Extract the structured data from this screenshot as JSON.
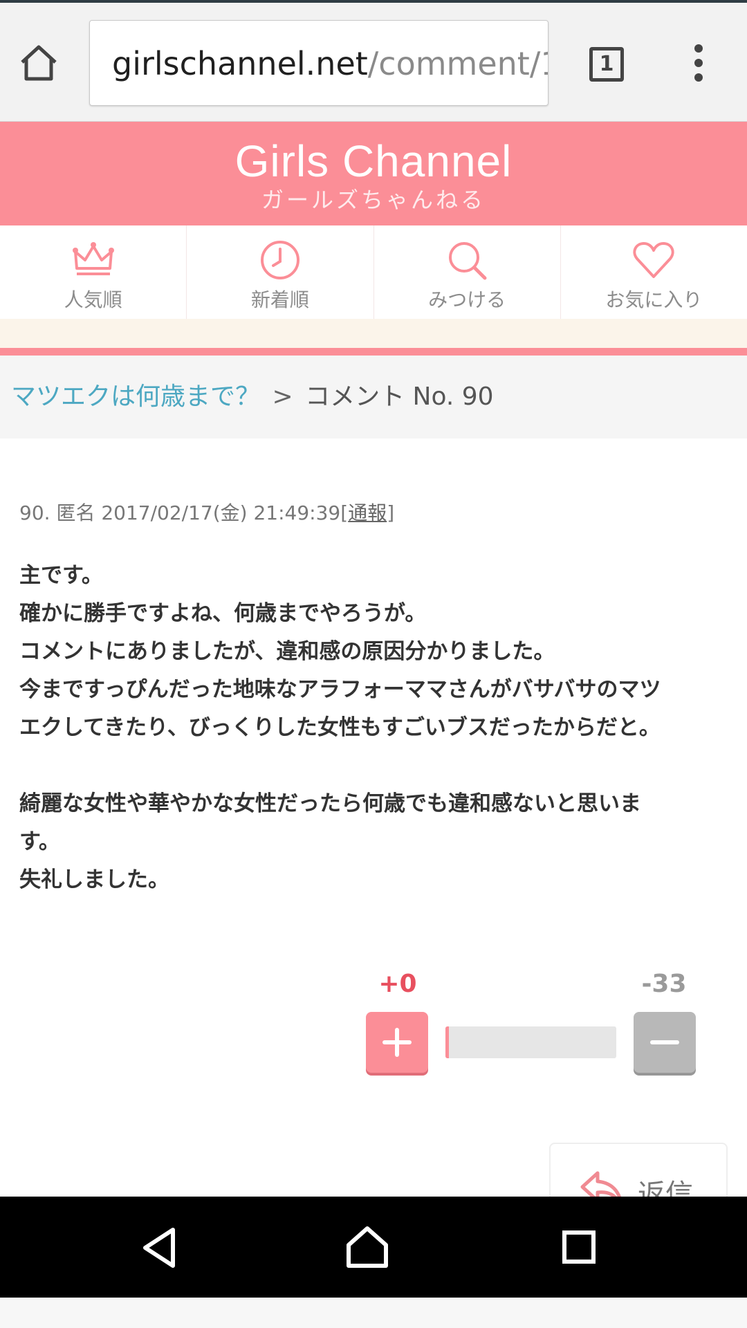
{
  "browser": {
    "url_host": "girlschannel.net",
    "url_path": "/comment/1",
    "tab_count": "1"
  },
  "site": {
    "logo_title": "Girls Channel",
    "logo_subtitle": "ガールズちゃんねる",
    "brand_color": "#fb8e97"
  },
  "nav": {
    "items": [
      {
        "label": "人気順",
        "icon": "crown-icon"
      },
      {
        "label": "新着順",
        "icon": "clock-icon"
      },
      {
        "label": "みつける",
        "icon": "search-icon"
      },
      {
        "label": "お気に入り",
        "icon": "heart-icon"
      }
    ]
  },
  "breadcrumb": {
    "topic_link": "マツエクは何歳まで？",
    "separator": ">",
    "current": "コメント No. 90"
  },
  "comment": {
    "number": "90.",
    "author": "匿名",
    "datetime": "2017/02/17(金) 21:49:39",
    "report_label": "通報",
    "lines": [
      "主です。",
      "確かに勝手ですよね、何歳までやろうが。",
      "コメントにありましたが、違和感の原因分かりました。",
      "今まですっぴんだった地味なアラフォーママさんがバサバサのマツ",
      "エクしてきたり、びっくりした女性もすごいブスだったからだと。",
      "",
      "綺麗な女性や華やかな女性だったら何歳でも違和感ないと思いま",
      "す。",
      "失礼しました。"
    ]
  },
  "votes": {
    "plus_count": "+0",
    "minus_count": "-33",
    "plus_fraction": 0.02
  },
  "reply": {
    "label": "返信"
  }
}
